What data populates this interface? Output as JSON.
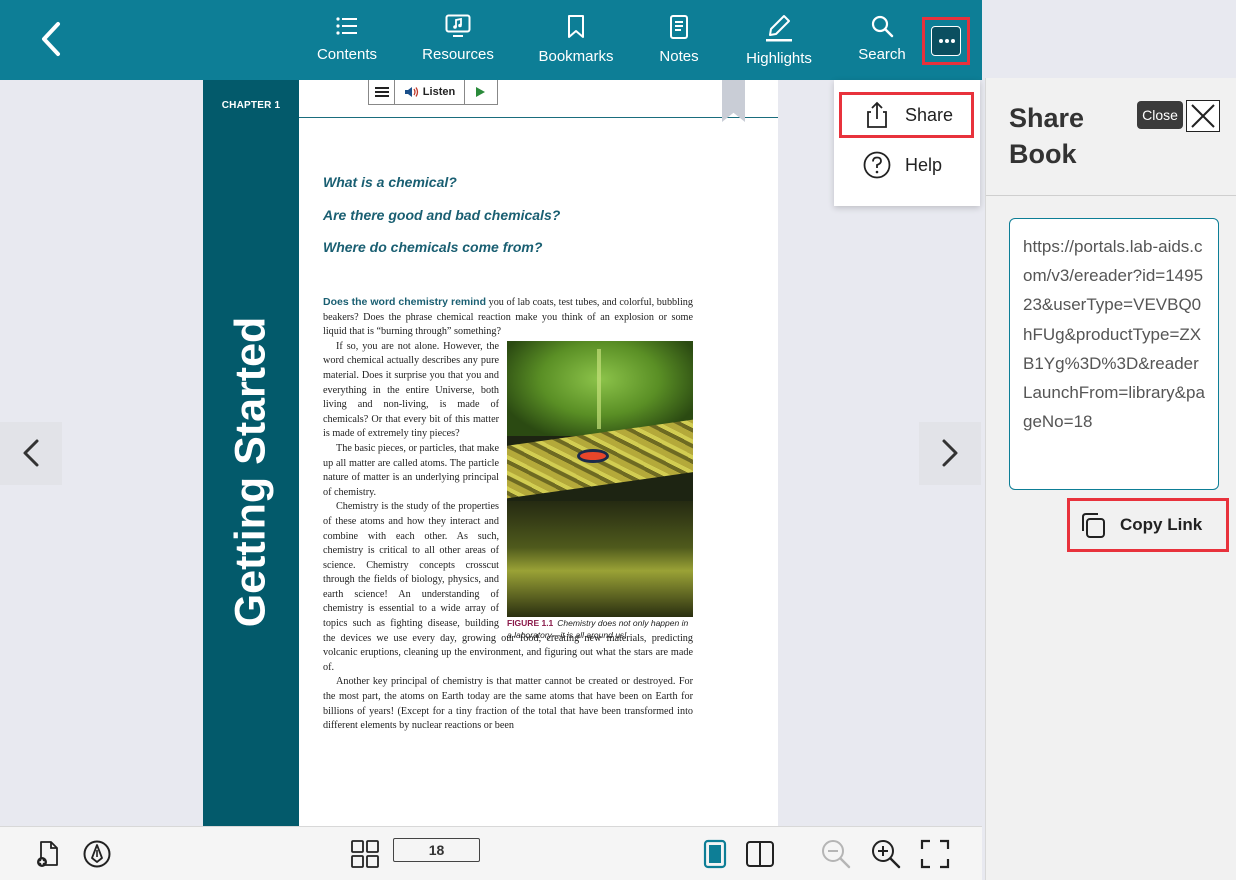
{
  "toolbar": {
    "contents_label": "Contents",
    "resources_label": "Resources",
    "bookmarks_label": "Bookmarks",
    "notes_label": "Notes",
    "highlights_label": "Highlights",
    "search_label": "Search"
  },
  "menu": {
    "share_label": "Share",
    "help_label": "Help"
  },
  "page": {
    "chapter_label": "CHAPTER 1",
    "vertical_title": "Getting Started",
    "listen_label": "Listen",
    "questions": [
      "What is a chemical?",
      "Are there good and bad chemicals?",
      "Where do chemicals come from?"
    ],
    "lead_text": "Does the word chemistry remind",
    "p1_rest": " you of lab coats, test tubes, and colorful, bubbling beakers? Does the phrase chemical reaction make you think of an explosion or some liquid that is “burning through” something?",
    "p2": "If so, you are not alone. However, the word chemical actually describes any pure material. Does it surprise you that you and everything in the entire Universe, both living and non-living, is made of chemicals? Or that every bit of this matter is made of extremely tiny pieces?",
    "p3": "The basic pieces, or particles, that make up all matter are called atoms. The particle nature of matter is an underlying principal of chemistry.",
    "p4": "Chemistry is the study of the properties of these atoms and how they interact and combine with each other. As such, chemistry is critical to all other areas of science. Chemistry concepts crosscut through the fields of biology, physics, and earth science! An understanding of chemistry is essential to a wide array of topics such as fighting disease, building the devices we use every day, growing our food, creating new materials, predicting volcanic eruptions, cleaning up the environment, and figuring out what the stars are made of.",
    "p5": "Another key principal of chemistry is that matter cannot be created or destroyed. For the most part, the atoms on Earth today are the same atoms that have been on Earth for billions of years! (Except for a tiny fraction of the total that have been transformed into different elements by nuclear reactions or been",
    "figure_label": "FIGURE 1.1",
    "figure_caption": "Chemistry does not only happen in a laboratory—it is all around us!"
  },
  "share_panel": {
    "title": "Share Book",
    "close_tooltip": "Close",
    "url": "https://portals.lab-aids.com/v3/ereader?id=149523&userType=VEVBQ0hFUg&productType=ZXB1Yg%3D%3D&readerLaunchFrom=library&pageNo=18",
    "copy_label": "Copy Link"
  },
  "bottombar": {
    "page_number": "18"
  },
  "colors": {
    "topbar": "#0d7e96",
    "chapter_band": "#035a6b",
    "highlight_frame": "#e8323c",
    "active_icon": "#0d7e96"
  }
}
